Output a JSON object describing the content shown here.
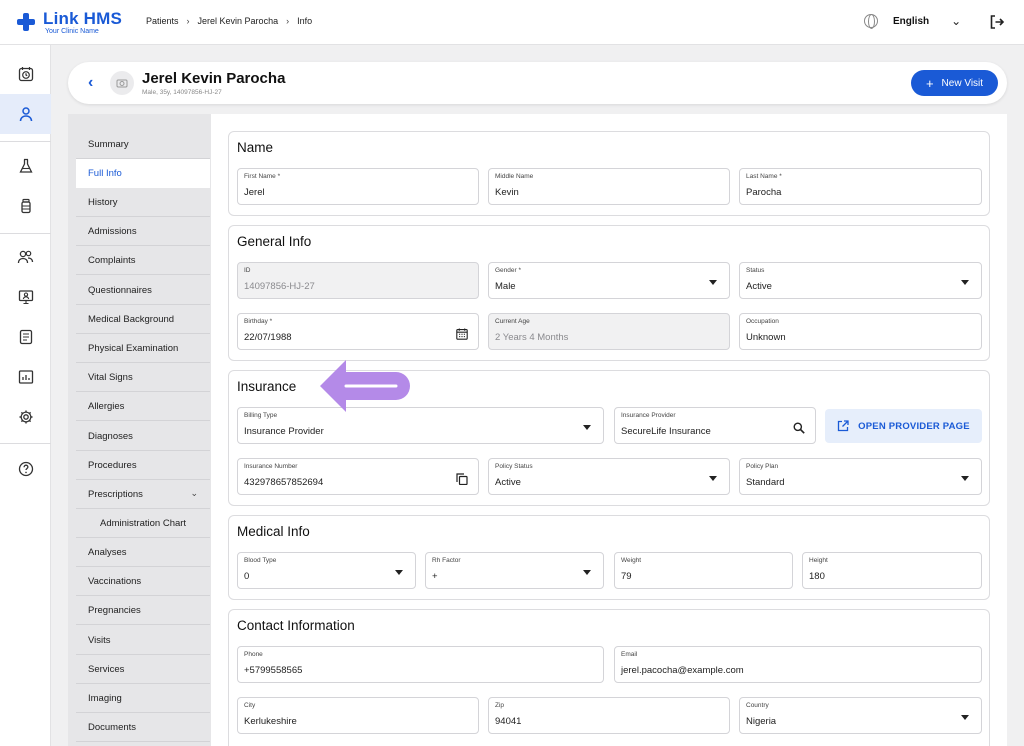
{
  "app": {
    "logo_title": "Link HMS",
    "logo_subtitle": "Your Clinic Name"
  },
  "breadcrumb": [
    "Patients",
    "Jerel Kevin Parocha",
    "Info"
  ],
  "language": "English",
  "patient": {
    "name": "Jerel Kevin Parocha",
    "meta": "Male, 35y, 14097856-HJ-27",
    "new_visit_label": "New Visit"
  },
  "nav": {
    "items": [
      "Summary",
      "Full Info",
      "History",
      "Admissions",
      "Complaints",
      "Questionnaires",
      "Medical Background",
      "Physical Examination",
      "Vital Signs",
      "Allergies",
      "Diagnoses",
      "Procedures",
      "Prescriptions",
      "Administration Chart",
      "Analyses",
      "Vaccinations",
      "Pregnancies",
      "Visits",
      "Services",
      "Imaging",
      "Documents"
    ],
    "active": "Full Info"
  },
  "sections": {
    "name": {
      "title": "Name",
      "first_label": "First Name *",
      "first_value": "Jerel",
      "middle_label": "Middle Name",
      "middle_value": "Kevin",
      "last_label": "Last Name *",
      "last_value": "Parocha"
    },
    "general": {
      "title": "General Info",
      "id_label": "ID",
      "id_value": "14097856-HJ-27",
      "gender_label": "Gender *",
      "gender_value": "Male",
      "status_label": "Status",
      "status_value": "Active",
      "birthday_label": "Birthday *",
      "birthday_value": "22/07/1988",
      "age_label": "Current Age",
      "age_value": "2 Years 4 Months",
      "occupation_label": "Occupation",
      "occupation_value": "Unknown"
    },
    "insurance": {
      "title": "Insurance",
      "billing_label": "Billing Type",
      "billing_value": "Insurance Provider",
      "provider_label": "Insurance Provider",
      "provider_value": "SecureLife Insurance",
      "open_provider_label": "OPEN PROVIDER PAGE",
      "number_label": "Insurance Number",
      "number_value": "432978657852694",
      "policy_status_label": "Policy Status",
      "policy_status_value": "Active",
      "policy_plan_label": "Policy Plan",
      "policy_plan_value": "Standard"
    },
    "medical": {
      "title": "Medical Info",
      "blood_label": "Blood Type",
      "blood_value": "0",
      "rh_label": "Rh Factor",
      "rh_value": "+",
      "weight_label": "Weight",
      "weight_value": "79",
      "height_label": "Height",
      "height_value": "180"
    },
    "contact": {
      "title": "Contact Information",
      "phone_label": "Phone",
      "phone_value": "+5799558565",
      "email_label": "Email",
      "email_value": "jerel.pacocha@example.com",
      "city_label": "City",
      "city_value": "Kerlukeshire",
      "zip_label": "Zip",
      "zip_value": "94041",
      "country_label": "Country",
      "country_value": "Nigeria"
    }
  },
  "colors": {
    "accent": "#1a5ad6",
    "annotation_arrow": "#b48ae8"
  },
  "icons": {
    "rail": [
      "calendar-clock-icon",
      "user-icon",
      "flask-icon",
      "medicine-bottle-icon",
      "users-icon",
      "monitor-person-icon",
      "clipboard-icon",
      "chart-board-icon",
      "gear-icon",
      "help-icon"
    ]
  }
}
